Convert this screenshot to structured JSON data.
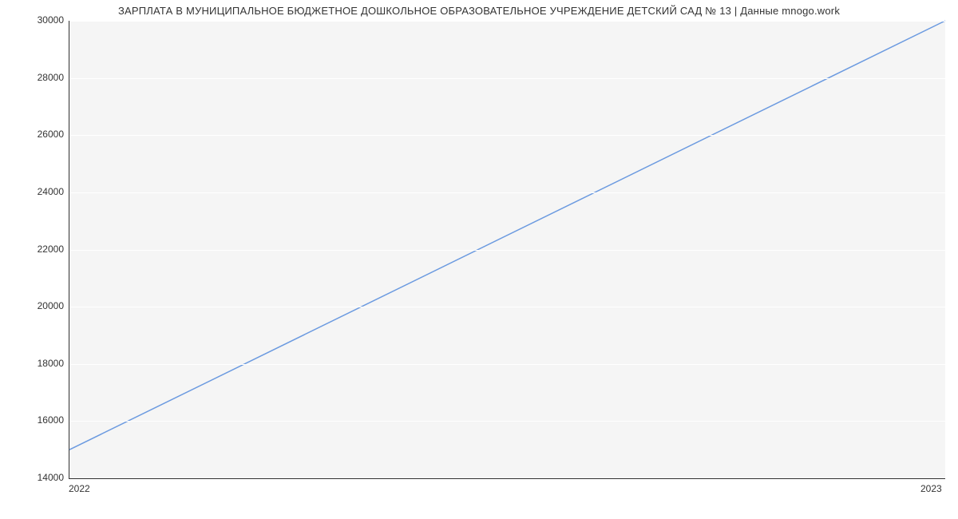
{
  "chart_data": {
    "type": "line",
    "title": "ЗАРПЛАТА В МУНИЦИПАЛЬНОЕ БЮДЖЕТНОЕ ДОШКОЛЬНОЕ ОБРАЗОВАТЕЛЬНОЕ УЧРЕЖДЕНИЕ ДЕТСКИЙ САД № 13 | Данные mnogo.work",
    "xlabel": "",
    "ylabel": "",
    "x": [
      2022,
      2023
    ],
    "values": [
      15000,
      30000
    ],
    "x_ticks": [
      "2022",
      "2023"
    ],
    "y_ticks": [
      14000,
      16000,
      18000,
      20000,
      22000,
      24000,
      26000,
      28000,
      30000
    ],
    "ylim": [
      14000,
      30000
    ],
    "xlim": [
      2022,
      2023
    ],
    "line_color": "#6b9ae0",
    "grid": true
  }
}
